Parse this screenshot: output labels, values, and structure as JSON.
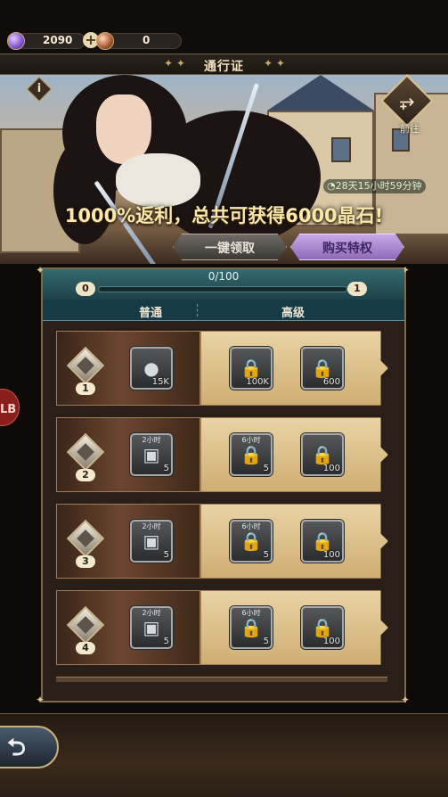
{
  "currency": {
    "crystal_value": "2090",
    "plus_label": "+",
    "secondary_value": "0"
  },
  "title": {
    "text": "通行证",
    "deco_left": "✦ ✦",
    "deco_right": "✦ ✦"
  },
  "banner": {
    "info_label": "i",
    "go_label": "前往",
    "go_icon": "⥅",
    "timer": "28天15小时59分钟",
    "promo_text": "1000%返利，总共可获得6000晶石!",
    "claim_all_label": "一键领取",
    "buy_privilege_label": "购买特权"
  },
  "side_badge": "LB",
  "progress": {
    "text": "0/100",
    "fraction": 0,
    "current_level": "0",
    "next_level": "1"
  },
  "columns": {
    "free": "普通",
    "premium": "高级"
  },
  "rows": [
    {
      "level": "1",
      "free": {
        "icon": "crystal-orb-icon",
        "count": "15K",
        "tag": ""
      },
      "premium": [
        {
          "icon": "locked-crystal-orb-icon",
          "count": "100K",
          "tag": ""
        },
        {
          "icon": "locked-gem-shard-icon",
          "count": "600",
          "tag": ""
        }
      ]
    },
    {
      "level": "2",
      "free": {
        "icon": "time-chest-icon",
        "count": "5",
        "tag": "2小时"
      },
      "premium": [
        {
          "icon": "locked-time-chest-icon",
          "count": "5",
          "tag": "6小时"
        },
        {
          "icon": "locked-gem-shard-icon",
          "count": "100",
          "tag": ""
        }
      ]
    },
    {
      "level": "3",
      "free": {
        "icon": "time-chest-icon",
        "count": "5",
        "tag": "2小时"
      },
      "premium": [
        {
          "icon": "locked-time-chest-icon",
          "count": "5",
          "tag": "6小时"
        },
        {
          "icon": "locked-gem-shard-icon",
          "count": "100",
          "tag": ""
        }
      ]
    },
    {
      "level": "4",
      "free": {
        "icon": "time-chest-icon",
        "count": "5",
        "tag": "2小时"
      },
      "premium": [
        {
          "icon": "locked-time-chest-icon",
          "count": "5",
          "tag": "6小时"
        },
        {
          "icon": "locked-gem-shard-icon",
          "count": "100",
          "tag": ""
        }
      ]
    }
  ],
  "footer": {
    "back_icon": "back-arrow-icon"
  },
  "colors": {
    "premium_button": "#a985cf",
    "progress_header": "#2a5a60",
    "row_premium": "#ddc08a"
  }
}
